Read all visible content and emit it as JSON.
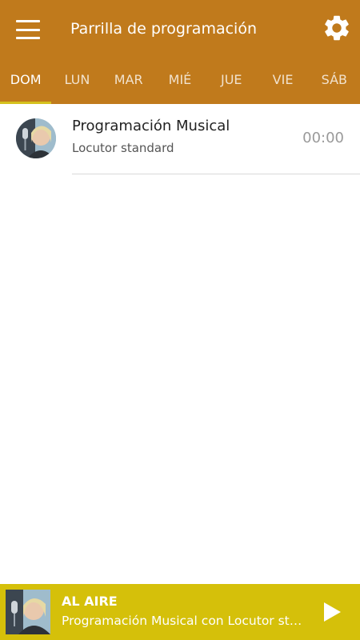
{
  "header": {
    "title": "Parrilla de programación",
    "menu_icon": "hamburger-menu-icon",
    "settings_icon": "gear-icon",
    "background_color": "#c07a1c"
  },
  "tabs": [
    {
      "label": "DOM",
      "active": true
    },
    {
      "label": "LUN",
      "active": false
    },
    {
      "label": "MAR",
      "active": false
    },
    {
      "label": "MIÉ",
      "active": false
    },
    {
      "label": "JUE",
      "active": false
    },
    {
      "label": "VIE",
      "active": false
    },
    {
      "label": "SÁB",
      "active": false
    }
  ],
  "tab_indicator_color": "#d5c11d",
  "schedule": [
    {
      "title": "Programación Musical",
      "host": "Locutor standard",
      "time": "00:00"
    }
  ],
  "player": {
    "label": "AL AIRE",
    "now_playing": "Programación Musical con Locutor standard",
    "play_icon": "play-icon",
    "background_color": "#d5c00a"
  }
}
